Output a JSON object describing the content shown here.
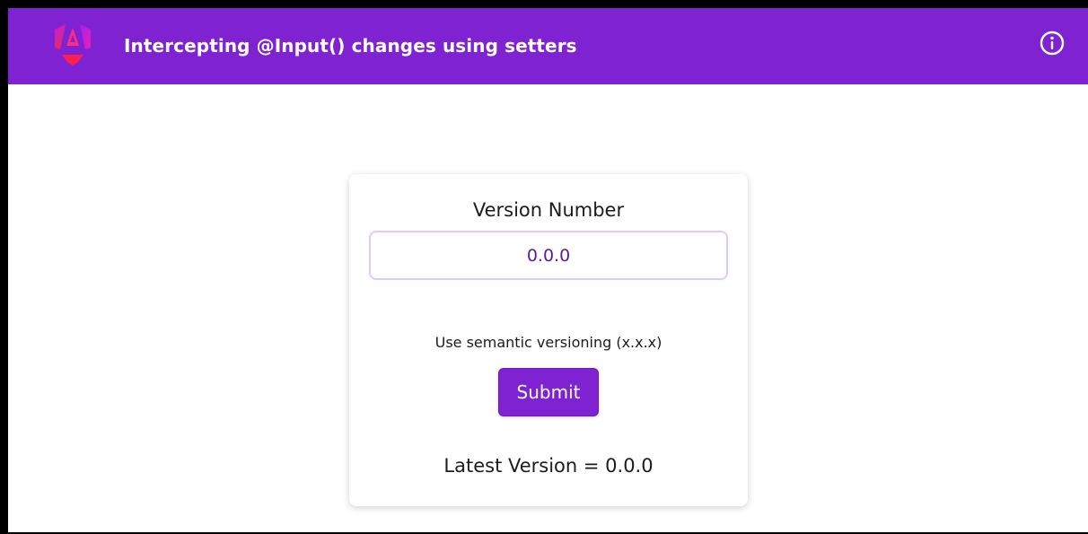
{
  "header": {
    "title": "Intercepting @Input() changes using setters",
    "background": "#7f23d2",
    "logo_icon": "angular-logo-icon",
    "info_icon": "info-circle-icon"
  },
  "card": {
    "field_label": "Version Number",
    "input_value": "0.0.0",
    "hint": "Use semantic versioning (x.x.x)",
    "submit_label": "Submit",
    "latest_label": "Latest Version = ",
    "latest_value": "0.0.0"
  },
  "colors": {
    "accent": "#7f23d2",
    "input_border": "#e3c8fa",
    "input_text": "#5b1a96"
  }
}
